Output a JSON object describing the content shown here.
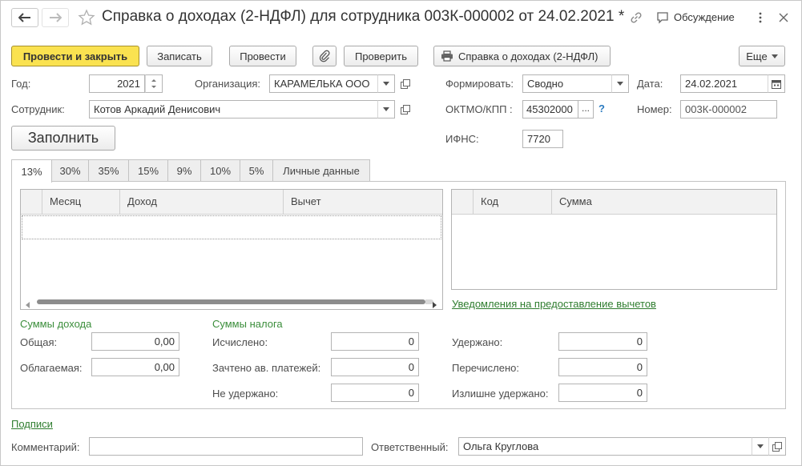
{
  "window": {
    "title": "Справка о доходах (2-НДФЛ) для сотрудника 003К-000002 от 24.02.2021 *",
    "discussion_label": "Обсуждение"
  },
  "toolbar": {
    "post_close_label": "Провести и закрыть",
    "save_label": "Записать",
    "post_label": "Провести",
    "check_label": "Проверить",
    "print_label": "Справка о доходах (2-НДФЛ)",
    "more_label": "Еще"
  },
  "form": {
    "year": {
      "label": "Год:",
      "value": "2021"
    },
    "organization": {
      "label": "Организация:",
      "value": "КАРАМЕЛЬКА ООО"
    },
    "form_mode": {
      "label": "Формировать:",
      "value": "Сводно"
    },
    "date": {
      "label": "Дата:",
      "value": "24.02.2021"
    },
    "employee": {
      "label": "Сотрудник:",
      "value": "Котов Аркадий Денисович"
    },
    "oktmo": {
      "label": "ОКТМО/КПП :",
      "value": "45302000",
      "ellipsis": "...",
      "help": "?"
    },
    "number": {
      "label": "Номер:",
      "value": "003К-000002"
    },
    "fill_label": "Заполнить",
    "ifns": {
      "label": "ИФНС:",
      "value": "7720"
    }
  },
  "tabs": [
    {
      "label": "13%"
    },
    {
      "label": "30%"
    },
    {
      "label": "35%"
    },
    {
      "label": "15%"
    },
    {
      "label": "9%"
    },
    {
      "label": "10%"
    },
    {
      "label": "5%"
    },
    {
      "label": "Личные данные"
    }
  ],
  "income_table": {
    "columns": [
      "Месяц",
      "Доход",
      "Вычет"
    ]
  },
  "deduction_table": {
    "columns": [
      "Код",
      "Сумма"
    ]
  },
  "notifications_link": "Уведомления на предоставление вычетов",
  "income_sums": {
    "title": "Суммы дохода",
    "total": {
      "label": "Общая:",
      "value": "0,00"
    },
    "taxable": {
      "label": "Облагаемая:",
      "value": "0,00"
    }
  },
  "tax_sums": {
    "title": "Суммы налога",
    "calculated": {
      "label": "Исчислено:",
      "value": "0"
    },
    "advance": {
      "label": "Зачтено ав. платежей:",
      "value": "0"
    },
    "not_withheld": {
      "label": "Не удержано:",
      "value": "0"
    },
    "withheld": {
      "label": "Удержано:",
      "value": "0"
    },
    "transferred": {
      "label": "Перечислено:",
      "value": "0"
    },
    "excess_withheld": {
      "label": "Излишне удержано:",
      "value": "0"
    }
  },
  "signatures_link": "Подписи",
  "comment": {
    "label": "Комментарий:",
    "value": ""
  },
  "responsible": {
    "label": "Ответственный:",
    "value": "Ольга Круглова"
  },
  "colors": {
    "primary_button": "#fae250",
    "green_text": "#3b8e3b",
    "help": "#2b7bc0"
  }
}
